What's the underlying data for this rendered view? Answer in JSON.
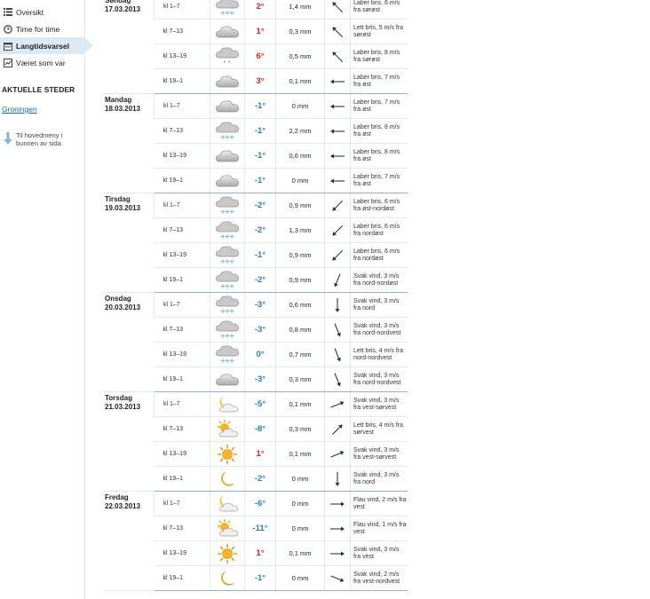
{
  "sidebar": {
    "nav": [
      {
        "label": "Oversikt",
        "icon": "list-icon",
        "active": false
      },
      {
        "label": "Time for time",
        "icon": "clock-icon",
        "active": false
      },
      {
        "label": "Langtidsvarsel",
        "icon": "calendar-icon",
        "active": true
      },
      {
        "label": "Været som var",
        "icon": "chart-icon",
        "active": false
      }
    ],
    "section_title": "AKTUELLE STEDER",
    "place": "Groningen",
    "main_menu_link": "Til hovedmeny i bunnen av sida"
  },
  "forecast": [
    {
      "day": "Søndag",
      "date": "17.03.2013",
      "rows": [
        {
          "period": "kl 1–7",
          "icon": "cloud-snow",
          "temp": "2°",
          "precip": "1,4 mm",
          "wind_dir": "nw",
          "wind": "Laber bris, 6 m/s fra sørøst"
        },
        {
          "period": "kl 7–13",
          "icon": "cloud",
          "temp": "1°",
          "precip": "0,3 mm",
          "wind_dir": "nw",
          "wind": "Lett bris, 5 m/s fra sørøst"
        },
        {
          "period": "kl 13–19",
          "icon": "cloud-rain",
          "temp": "6°",
          "precip": "0,5 mm",
          "wind_dir": "nw",
          "wind": "Laber bris, 8 m/s fra sørøst"
        },
        {
          "period": "kl 19–1",
          "icon": "cloud",
          "temp": "3°",
          "precip": "0,1 mm",
          "wind_dir": "w",
          "wind": "Laber bris, 7 m/s fra øst"
        }
      ]
    },
    {
      "day": "Mandag",
      "date": "18.03.2013",
      "rows": [
        {
          "period": "kl 1–7",
          "icon": "cloud",
          "temp": "-1°",
          "precip": "0 mm",
          "wind_dir": "w",
          "wind": "Laber bris, 7 m/s fra øst"
        },
        {
          "period": "kl 7–13",
          "icon": "cloud-snow",
          "temp": "-1°",
          "precip": "2,2 mm",
          "wind_dir": "w",
          "wind": "Laber bris, 8 m/s fra øst"
        },
        {
          "period": "kl 13–19",
          "icon": "cloud",
          "temp": "-1°",
          "precip": "0,6 mm",
          "wind_dir": "w",
          "wind": "Laber bris, 8 m/s fra øst"
        },
        {
          "period": "kl 19–1",
          "icon": "cloud",
          "temp": "-1°",
          "precip": "0 mm",
          "wind_dir": "w",
          "wind": "Laber bris, 7 m/s fra øst"
        }
      ]
    },
    {
      "day": "Tirsdag",
      "date": "19.03.2013",
      "rows": [
        {
          "period": "kl 1–7",
          "icon": "cloud-snow",
          "temp": "-2°",
          "precip": "0,9 mm",
          "wind_dir": "sw",
          "wind": "Laber bris, 6 m/s fra øst-nordøst"
        },
        {
          "period": "kl 7–13",
          "icon": "cloud-snow",
          "temp": "-2°",
          "precip": "1,3 mm",
          "wind_dir": "sw",
          "wind": "Laber bris, 6 m/s fra nordøst"
        },
        {
          "period": "kl 13–19",
          "icon": "cloud-snow",
          "temp": "-1°",
          "precip": "0,9 mm",
          "wind_dir": "sw",
          "wind": "Laber bris, 6 m/s fra nordøst"
        },
        {
          "period": "kl 19–1",
          "icon": "cloud-snow",
          "temp": "-2°",
          "precip": "0,9 mm",
          "wind_dir": "ssw",
          "wind": "Svak vind, 3 m/s fra nord-nordøst"
        }
      ]
    },
    {
      "day": "Onsdag",
      "date": "20.03.2013",
      "rows": [
        {
          "period": "kl 1–7",
          "icon": "cloud-snow",
          "temp": "-3°",
          "precip": "0,6 mm",
          "wind_dir": "s",
          "wind": "Svak vind, 3 m/s fra nord"
        },
        {
          "period": "kl 7–13",
          "icon": "cloud-snow",
          "temp": "-3°",
          "precip": "0,8 mm",
          "wind_dir": "sse",
          "wind": "Svak vind, 3 m/s fra nord-nordvest"
        },
        {
          "period": "kl 13–19",
          "icon": "cloud-snow",
          "temp": "0°",
          "precip": "0,7 mm",
          "wind_dir": "sse",
          "wind": "Lett bris, 4 m/s fra nord-nordvest"
        },
        {
          "period": "kl 19–1",
          "icon": "cloud",
          "temp": "-3°",
          "precip": "0,3 mm",
          "wind_dir": "sse",
          "wind": "Svak vind, 3 m/s fra nord-nordvest"
        }
      ]
    },
    {
      "day": "Torsdag",
      "date": "21.03.2013",
      "rows": [
        {
          "period": "kl 1–7",
          "icon": "moon-cloud",
          "temp": "-5°",
          "precip": "0,1 mm",
          "wind_dir": "ene",
          "wind": "Svak vind, 3 m/s fra vest-sørvest"
        },
        {
          "period": "kl 7–13",
          "icon": "sun-cloud",
          "temp": "-8°",
          "precip": "0,3 mm",
          "wind_dir": "ne",
          "wind": "Lett bris, 4 m/s fra sørvest"
        },
        {
          "period": "kl 13–19",
          "icon": "sun",
          "temp": "1°",
          "precip": "0,1 mm",
          "wind_dir": "ene",
          "wind": "Svak vind, 3 m/s fra vest-sørvest"
        },
        {
          "period": "kl 19–1",
          "icon": "moon",
          "temp": "-2°",
          "precip": "0 mm",
          "wind_dir": "s",
          "wind": "Svak vind, 3 m/s fra nord"
        }
      ]
    },
    {
      "day": "Fredag",
      "date": "22.03.2013",
      "rows": [
        {
          "period": "kl 1–7",
          "icon": "moon-cloud",
          "temp": "-6°",
          "precip": "0 mm",
          "wind_dir": "e",
          "wind": "Flau vind, 2 m/s fra vest"
        },
        {
          "period": "kl 7–13",
          "icon": "sun-cloud",
          "temp": "-11°",
          "precip": "0 mm",
          "wind_dir": "e",
          "wind": "Flau vind, 1 m/s fra vest"
        },
        {
          "period": "kl 13–19",
          "icon": "sun",
          "temp": "1°",
          "precip": "0,1 mm",
          "wind_dir": "e",
          "wind": "Svak vind, 3 m/s fra vest"
        },
        {
          "period": "kl 19–1",
          "icon": "moon",
          "temp": "-1°",
          "precip": "0 mm",
          "wind_dir": "ese",
          "wind": "Svak vind, 2 m/s fra vest-nordvest"
        }
      ]
    }
  ]
}
